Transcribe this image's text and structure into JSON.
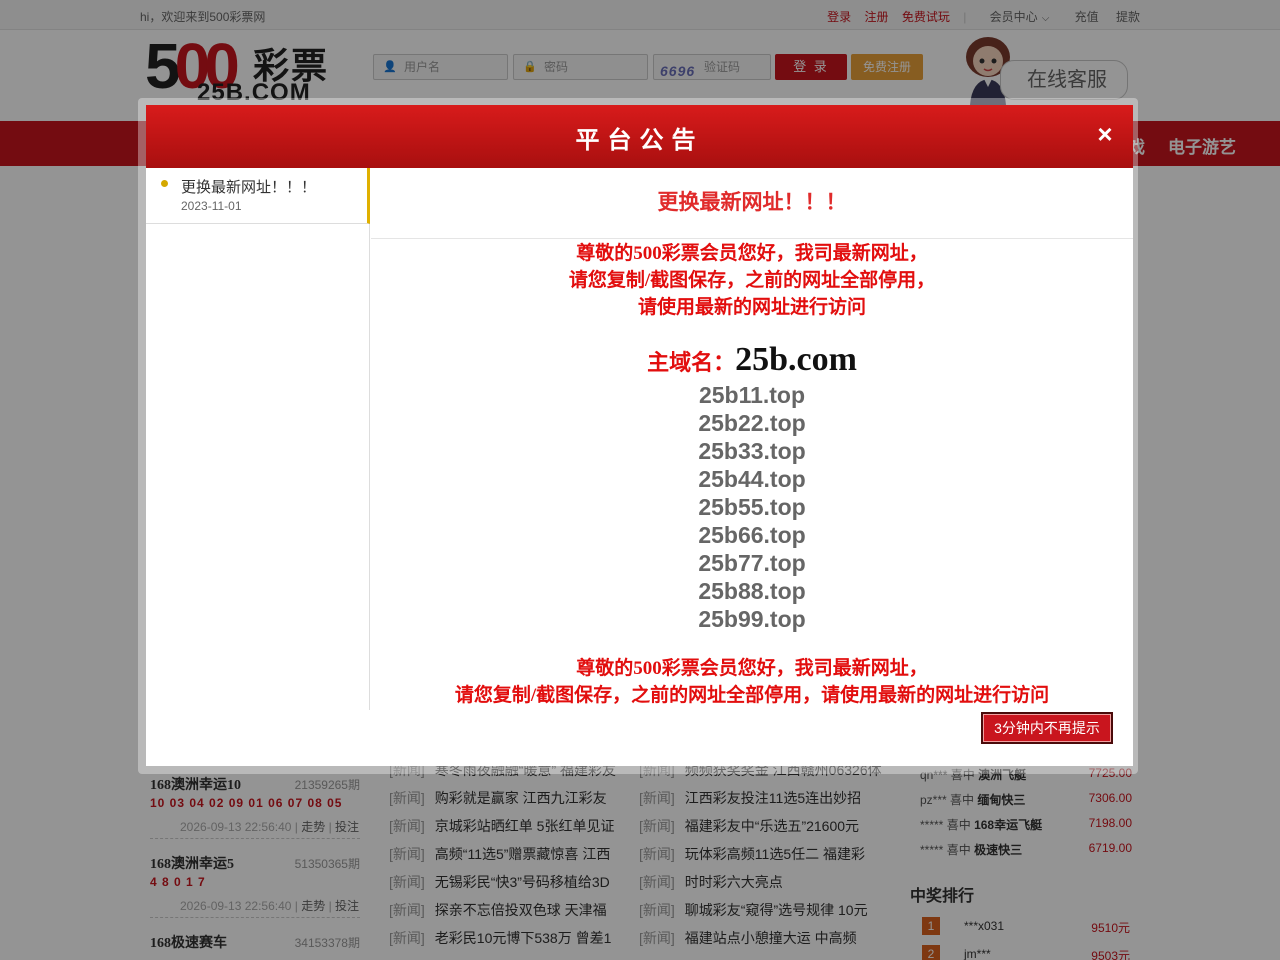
{
  "topbar": {
    "welcome": "hi，欢迎来到500彩票网",
    "login": "登录",
    "register": "注册",
    "trial": "免费试玩",
    "member_center": "会员中心",
    "recharge": "充值",
    "withdraw": "提款"
  },
  "header": {
    "logo_num_5": "5",
    "logo_num_00": "00",
    "logo_cn": "彩票",
    "logo_domain": "25B.COM",
    "username_placeholder": "用户名",
    "password_placeholder": "密码",
    "captcha_code": "6696",
    "captcha_placeholder": "验证码",
    "login_button": "登 录",
    "register_button": "免费注册",
    "service_label": "在线客服"
  },
  "nav": {
    "item_partial": "戏",
    "item_egame": "电子游艺"
  },
  "lotteries": [
    {
      "name": "168澳洲幸运10",
      "period": "21359265期",
      "numbers": "10 03 04 02 09 01 06 07 08 05",
      "time": "2026-09-13 22:56:40",
      "trend": "走势",
      "bet": "投注"
    },
    {
      "name": "168澳洲幸运5",
      "period": "51350365期",
      "numbers": "4 8 0 1 7",
      "time": "2026-09-13 22:56:40",
      "trend": "走势",
      "bet": "投注"
    },
    {
      "name": "168极速赛车",
      "period": "34153378期",
      "numbers": "",
      "time": "",
      "trend": "",
      "bet": ""
    }
  ],
  "news_left": [
    {
      "tag": "[新闻]",
      "title": "寒冬雨夜融融“暖意” 福建彩友"
    },
    {
      "tag": "[新闻]",
      "title": "购彩就是赢家 江西九江彩友"
    },
    {
      "tag": "[新闻]",
      "title": "京城彩站晒红单 5张红单见证"
    },
    {
      "tag": "[新闻]",
      "title": "高频“11选5”赠票藏惊喜 江西"
    },
    {
      "tag": "[新闻]",
      "title": "无锡彩民“快3”号码移植给3D"
    },
    {
      "tag": "[新闻]",
      "title": "探亲不忘倍投双色球 天津福"
    },
    {
      "tag": "[新闻]",
      "title": "老彩民10元博下538万 曾差1"
    }
  ],
  "news_right": [
    {
      "tag": "[新闻]",
      "title": "频频获奖奖金 江西赣州06326体"
    },
    {
      "tag": "[新闻]",
      "title": "江西彩友投注11选5连出妙招"
    },
    {
      "tag": "[新闻]",
      "title": "福建彩友中“乐选五”21600元"
    },
    {
      "tag": "[新闻]",
      "title": "玩体彩高频11选5任二 福建彩"
    },
    {
      "tag": "[新闻]",
      "title": "时时彩六大亮点"
    },
    {
      "tag": "[新闻]",
      "title": "聊城彩友“窥得”选号规律 10元"
    },
    {
      "tag": "[新闻]",
      "title": "福建站点小憩撞大运 中高频"
    }
  ],
  "winners": [
    {
      "user": "qn***",
      "verb": "喜中",
      "game": "澳洲飞艇",
      "amount": "7725.00"
    },
    {
      "user": "pz***",
      "verb": "喜中",
      "game": "缅甸快三",
      "amount": "7306.00"
    },
    {
      "user": "*****",
      "verb": "喜中",
      "game": "168幸运飞艇",
      "amount": "7198.00"
    },
    {
      "user": "*****",
      "verb": "喜中",
      "game": "极速快三",
      "amount": "6719.00"
    }
  ],
  "ranking": {
    "title": "中奖排行",
    "rows": [
      {
        "no": "1",
        "user": "***x031",
        "amount": "9510元"
      },
      {
        "no": "2",
        "user": "jm***",
        "amount": "9503元"
      }
    ]
  },
  "modal": {
    "title": "平台公告",
    "close": "×",
    "side_items": [
      {
        "title": "更换最新网址！！！",
        "date": "2023-11-01"
      }
    ],
    "content_title": "更换最新网址！！！",
    "lines": [
      "尊敬的500彩票会员您好，我司最新网址，",
      "请您复制/截图保存，之前的网址全部停用，",
      "请使用最新的网址进行访问"
    ],
    "main_domain_label": "主域名：",
    "main_domain": "25b.com",
    "mirrors": [
      "25b11.top",
      "25b22.top",
      "25b33.top",
      "25b44.top",
      "25b55.top",
      "25b66.top",
      "25b77.top",
      "25b88.top",
      "25b99.top"
    ],
    "lines_repeat_1": "尊敬的500彩票会员您好，我司最新网址，",
    "lines_repeat_2": "请您复制/截图保存，之前的网址全部停用，请使用最新的网址进行访问",
    "dismiss_button": "3分钟内不再提示"
  },
  "colors": {
    "brand_red": "#c9151e",
    "accent_orange": "#e8a13a",
    "notice_red": "#e20e0e"
  }
}
